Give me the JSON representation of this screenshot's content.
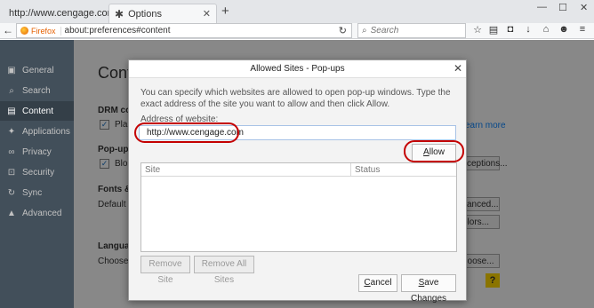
{
  "tabs": [
    {
      "title": "http://www.cengage.com/us/"
    },
    {
      "title": "Options"
    }
  ],
  "urlbar": {
    "identity": "Firefox",
    "url": "about:preferences#content"
  },
  "search": {
    "placeholder": "Search"
  },
  "sidebar": {
    "items": [
      {
        "label": "General"
      },
      {
        "label": "Search"
      },
      {
        "label": "Content"
      },
      {
        "label": "Applications"
      },
      {
        "label": "Privacy"
      },
      {
        "label": "Security"
      },
      {
        "label": "Sync"
      },
      {
        "label": "Advanced"
      }
    ],
    "selected": "Content"
  },
  "background": {
    "title": "Cont",
    "drm_heading": "DRM co",
    "drm_checkbox": "Pla",
    "learn_more": "earn more",
    "popups_heading": "Pop-up",
    "popups_checkbox": "Blo",
    "exceptions_button": "xceptions...",
    "fonts_heading": "Fonts &",
    "default_font": "Default f",
    "advanced_button": "vanced...",
    "colors_button": "olors...",
    "languages_heading": "Languag",
    "choose_text": "Choose y",
    "choose_button": "hoose...",
    "help_label": "?"
  },
  "dialog": {
    "title": "Allowed Sites - Pop-ups",
    "description": "You can specify which websites are allowed to open pop-up windows. Type the exact address of the site you want to allow and then click Allow.",
    "address_label": "Address of website:",
    "address_value": "http://www.cengage.com",
    "allow_button": "Allow",
    "columns": [
      "Site",
      "Status"
    ],
    "remove_site": "Remove Site",
    "remove_all_sites": "Remove All Sites",
    "cancel": "Cancel",
    "save_changes": "Save Changes"
  },
  "colors": {
    "annotation": "#c40000",
    "sidebar": "#424f5a"
  }
}
